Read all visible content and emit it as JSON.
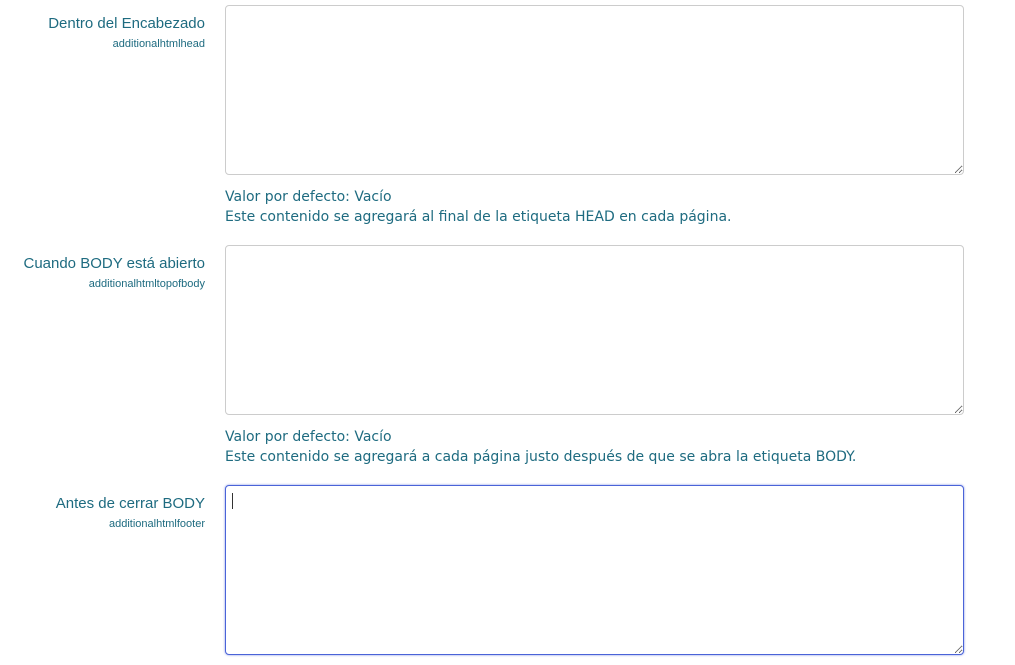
{
  "settings": [
    {
      "title": "Dentro del Encabezado",
      "key": "additionalhtmlhead",
      "value": "",
      "default_text": "Valor por defecto: Vacío",
      "description": "Este contenido se agregará al final de la etiqueta HEAD en cada página."
    },
    {
      "title": "Cuando BODY está abierto",
      "key": "additionalhtmltopofbody",
      "value": "",
      "default_text": "Valor por defecto: Vacío",
      "description": "Este contenido se agregará a cada página justo después de que se abra la etiqueta BODY."
    },
    {
      "title": "Antes de cerrar BODY",
      "key": "additionalhtmlfooter",
      "value": "",
      "focused": true
    }
  ],
  "colors": {
    "label": "#1e6b80",
    "field_border": "#cccccc",
    "focus_border": "#4a63d8"
  }
}
